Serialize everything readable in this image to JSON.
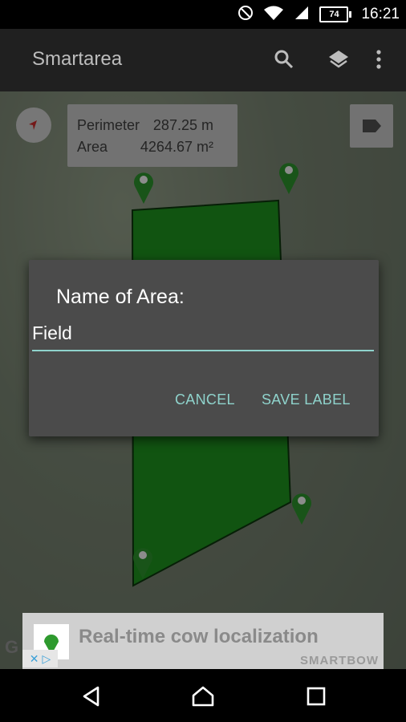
{
  "status_bar": {
    "battery": "74",
    "time": "16:21",
    "icons": [
      "do-not-disturb-icon",
      "wifi-icon",
      "signal-icon",
      "battery-icon"
    ]
  },
  "app_bar": {
    "title": "Smartarea",
    "actions": [
      "search-icon",
      "layers-icon",
      "more-vert-icon"
    ]
  },
  "map": {
    "measurements": {
      "perimeter_label": "Perimeter",
      "perimeter_value": "287.25",
      "perimeter_unit": "m",
      "area_label": "Area",
      "area_value": "4264.67",
      "area_unit": "m²"
    },
    "polygon_color": "#1f9a1f",
    "pin_color": "#2e9a2e"
  },
  "dialog": {
    "title": "Name of Area:",
    "input_value": "Field",
    "cancel_label": "CANCEL",
    "save_label": "SAVE LABEL",
    "accent": "#8fd3cc"
  },
  "ad": {
    "text": "Real-time cow localization",
    "brand": "SMARTBOW"
  },
  "map_attribution": "G",
  "nav_bar": {
    "buttons": [
      "back-icon",
      "home-icon",
      "recents-icon"
    ]
  }
}
